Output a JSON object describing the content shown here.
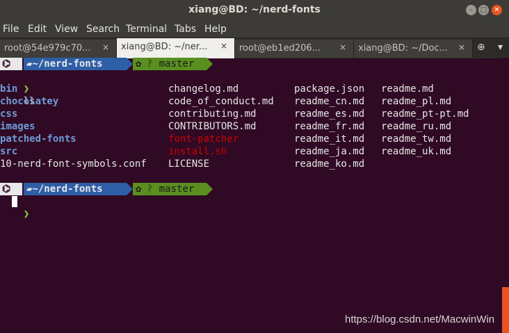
{
  "window": {
    "title": "xiang@BD: ~/nerd-fonts",
    "min": "–",
    "max": "□",
    "close": "✕"
  },
  "menu": [
    "File",
    "Edit",
    "View",
    "Search",
    "Terminal",
    "Tabs",
    "Help"
  ],
  "tabs": [
    {
      "label": "root@54e979c70...",
      "close": "×"
    },
    {
      "label": "xiang@BD: ~/ner...",
      "close": "×"
    },
    {
      "label": "root@eb1ed206...",
      "close": "×"
    },
    {
      "label": "xiang@BD: ~/Doc...",
      "close": "×"
    }
  ],
  "toolbar": {
    "new_tab_icon": "⊕",
    "menu_icon": "▾"
  },
  "prompt": {
    "os_icon": "⌬",
    "dir": "~/nerd-fonts",
    "dir_icon": "▰",
    "git_icon": "✿",
    "branch": "master",
    "branch_icon": "ᚹ"
  },
  "command": {
    "chev": "❯",
    "text": "ls"
  },
  "listing": {
    "col1": [
      {
        "name": "bin",
        "kind": "dir"
      },
      {
        "name": "chocolatey",
        "kind": "dir"
      },
      {
        "name": "css",
        "kind": "dir"
      },
      {
        "name": "images",
        "kind": "dir"
      },
      {
        "name": "patched-fonts",
        "kind": "dir"
      },
      {
        "name": "src",
        "kind": "dir"
      },
      {
        "name": "10-nerd-font-symbols.conf",
        "kind": "file"
      }
    ],
    "col2": [
      {
        "name": "changelog.md",
        "kind": "file"
      },
      {
        "name": "code_of_conduct.md",
        "kind": "file"
      },
      {
        "name": "contributing.md",
        "kind": "file"
      },
      {
        "name": "CONTRIBUTORS.md",
        "kind": "file"
      },
      {
        "name": "font-patcher",
        "kind": "exe"
      },
      {
        "name": "install.sh",
        "kind": "exe"
      },
      {
        "name": "LICENSE",
        "kind": "file"
      }
    ],
    "col3": [
      {
        "name": "package.json",
        "kind": "file"
      },
      {
        "name": "readme_cn.md",
        "kind": "file"
      },
      {
        "name": "readme_es.md",
        "kind": "file"
      },
      {
        "name": "readme_fr.md",
        "kind": "file"
      },
      {
        "name": "readme_it.md",
        "kind": "file"
      },
      {
        "name": "readme_ja.md",
        "kind": "file"
      },
      {
        "name": "readme_ko.md",
        "kind": "file"
      }
    ],
    "col4": [
      {
        "name": "readme.md",
        "kind": "file"
      },
      {
        "name": "readme_pl.md",
        "kind": "file"
      },
      {
        "name": "readme_pt-pt.md",
        "kind": "file"
      },
      {
        "name": "readme_ru.md",
        "kind": "file"
      },
      {
        "name": "readme_tw.md",
        "kind": "file"
      },
      {
        "name": "readme_uk.md",
        "kind": "file"
      }
    ]
  },
  "watermark": "https://blog.csdn.net/MacwinWin",
  "colors": {
    "accent": "#e95420",
    "background": "#300a24",
    "dir": "#6f9cd8",
    "exe": "#cc0000"
  }
}
